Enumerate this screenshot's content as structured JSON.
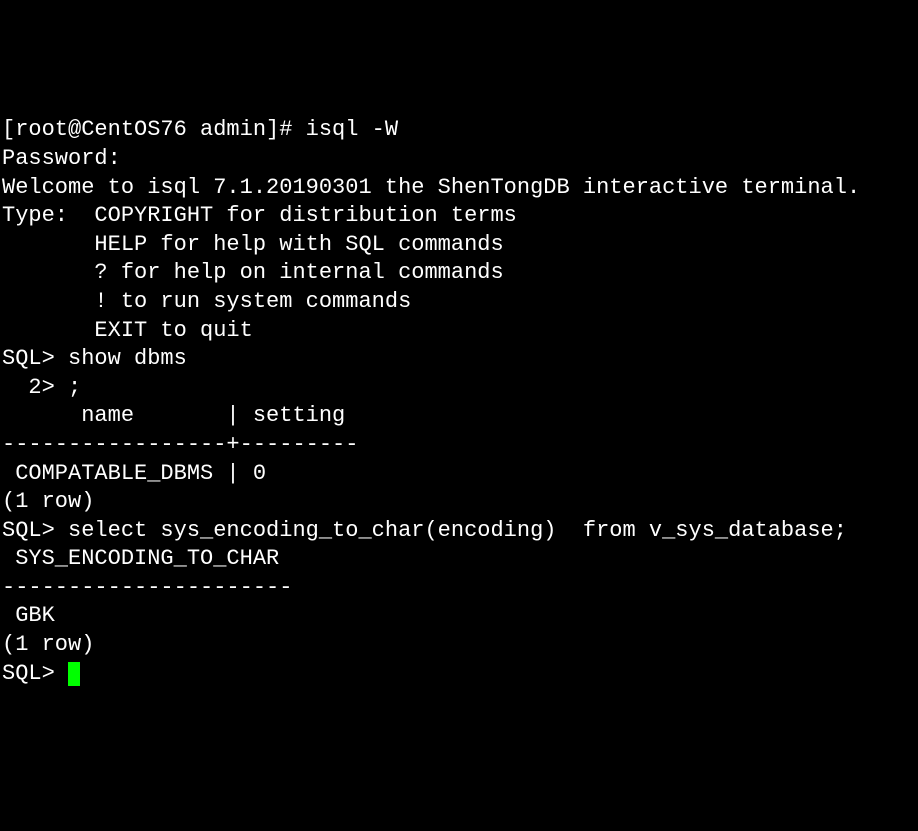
{
  "terminal": {
    "lines": {
      "l1": "[root@CentOS76 admin]# isql -W",
      "l2": "Password:",
      "l3": "Welcome to isql 7.1.20190301 the ShenTongDB interactive terminal.",
      "l4": "Type:  COPYRIGHT for distribution terms",
      "l5": "       HELP for help with SQL commands",
      "l6": "       ? for help on internal commands",
      "l7": "       ! to run system commands",
      "l8": "       EXIT to quit",
      "l9": "",
      "l10": "SQL> show dbms",
      "l11": "  2> ;",
      "l12": "      name       | setting",
      "l13": "-----------------+---------",
      "l14": " COMPATABLE_DBMS | 0",
      "l15": "(1 row)",
      "l16": "SQL> select sys_encoding_to_char(encoding)  from v_sys_database;",
      "l17": " SYS_ENCODING_TO_CHAR",
      "l18": "----------------------",
      "l19": " GBK",
      "l20": "(1 row)",
      "l21": "SQL> "
    }
  }
}
